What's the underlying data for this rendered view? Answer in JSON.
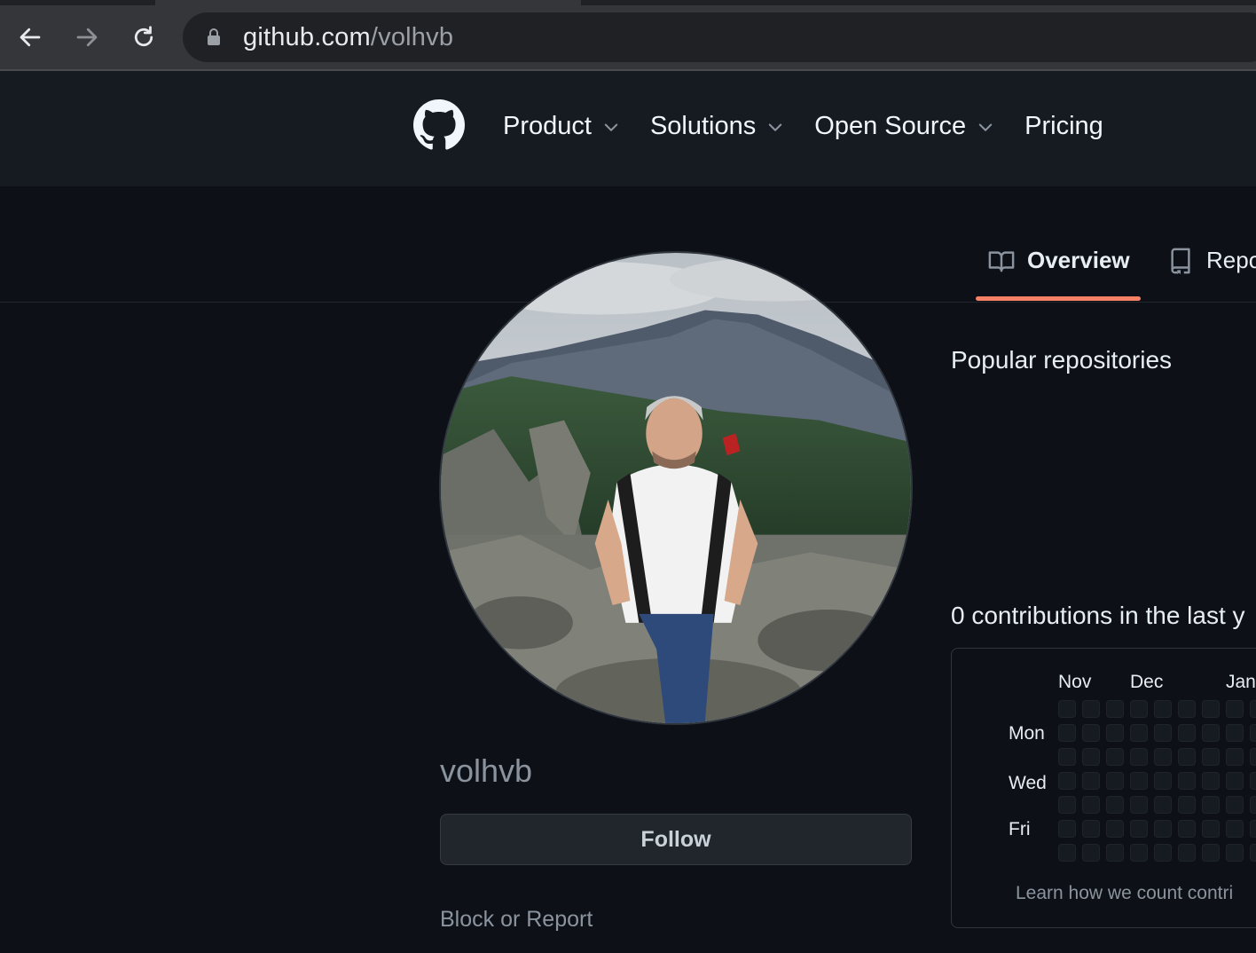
{
  "browser": {
    "url_host": "github.com",
    "url_path": "/volhvb"
  },
  "header": {
    "nav": [
      {
        "label": "Product",
        "has_menu": true
      },
      {
        "label": "Solutions",
        "has_menu": true
      },
      {
        "label": "Open Source",
        "has_menu": true
      },
      {
        "label": "Pricing",
        "has_menu": false
      }
    ]
  },
  "tabs": {
    "overview": "Overview",
    "repositories": "Repo"
  },
  "profile": {
    "username": "volhvb",
    "follow_label": "Follow",
    "block_label": "Block or Report"
  },
  "main": {
    "popular_title": "Popular repositories",
    "contrib_title": "0 contributions in the last y",
    "months": [
      "Nov",
      "Dec",
      "Jan"
    ],
    "days": [
      "Mon",
      "Wed",
      "Fri"
    ],
    "learn_label": "Learn how we count contri"
  },
  "colors": {
    "accent_underline": "#f78166",
    "background": "#0d1117"
  },
  "icons": [
    "back-arrow-icon",
    "forward-arrow-icon",
    "reload-icon",
    "lock-icon",
    "github-logo-icon",
    "chevron-down-icon",
    "book-icon",
    "repo-icon"
  ]
}
